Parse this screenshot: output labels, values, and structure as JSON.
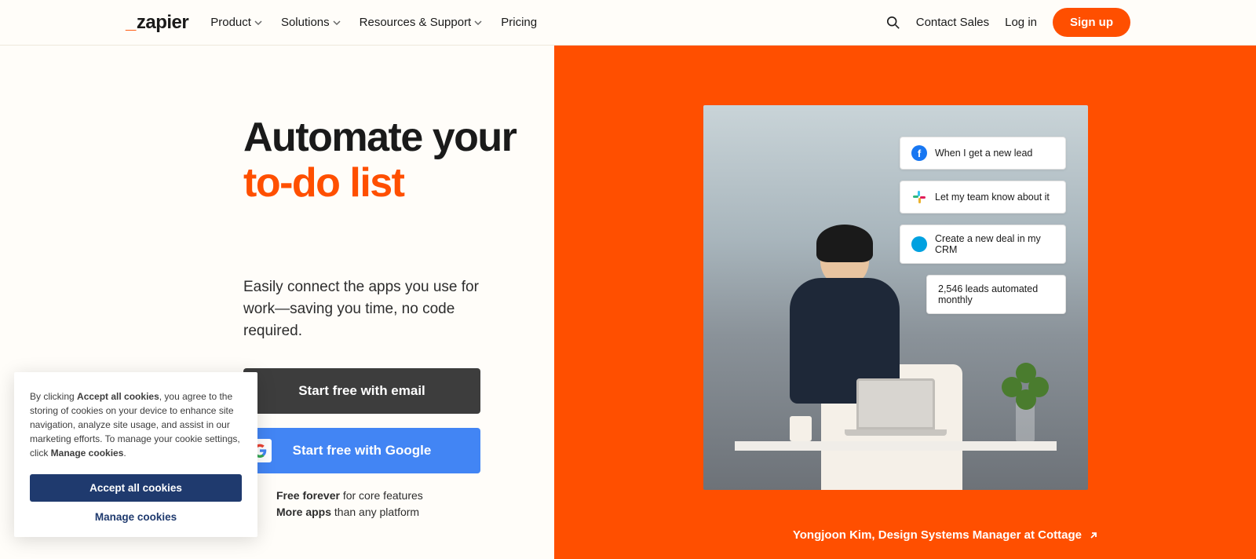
{
  "brand": "zapier",
  "nav": {
    "items": [
      {
        "label": "Product",
        "dropdown": true
      },
      {
        "label": "Solutions",
        "dropdown": true
      },
      {
        "label": "Resources & Support",
        "dropdown": true
      },
      {
        "label": "Pricing",
        "dropdown": false
      }
    ],
    "contact": "Contact Sales",
    "login": "Log in",
    "signup": "Sign up"
  },
  "hero": {
    "title_line1": "Automate your",
    "title_line2": "to-do list",
    "description": "Easily connect the apps you use for work—saving you time, no code required.",
    "cta_email": "Start free with email",
    "cta_google": "Start free with Google",
    "feature1_bold": "Free forever",
    "feature1_rest": " for core features",
    "feature2_bold": "More apps",
    "feature2_rest": " than any platform"
  },
  "steps": [
    {
      "icon": "facebook",
      "text": "When I get a new lead"
    },
    {
      "icon": "slack",
      "text": "Let my team know about it"
    },
    {
      "icon": "salesforce",
      "text": "Create a new deal in my CRM"
    },
    {
      "icon": null,
      "text": "2,546 leads automated monthly"
    }
  ],
  "caption": "Yongjoon Kim, Design Systems Manager at Cottage",
  "cookie": {
    "pre": "By clicking ",
    "bold1": "Accept all cookies",
    "mid": ", you agree to the storing of cookies on your device to enhance site navigation, analyze site usage, and assist in our marketing efforts. To manage your cookie settings, click ",
    "bold2": "Manage cookies",
    "post": ".",
    "accept": "Accept all cookies",
    "manage": "Manage cookies"
  },
  "colors": {
    "accent": "#ff4f00"
  }
}
